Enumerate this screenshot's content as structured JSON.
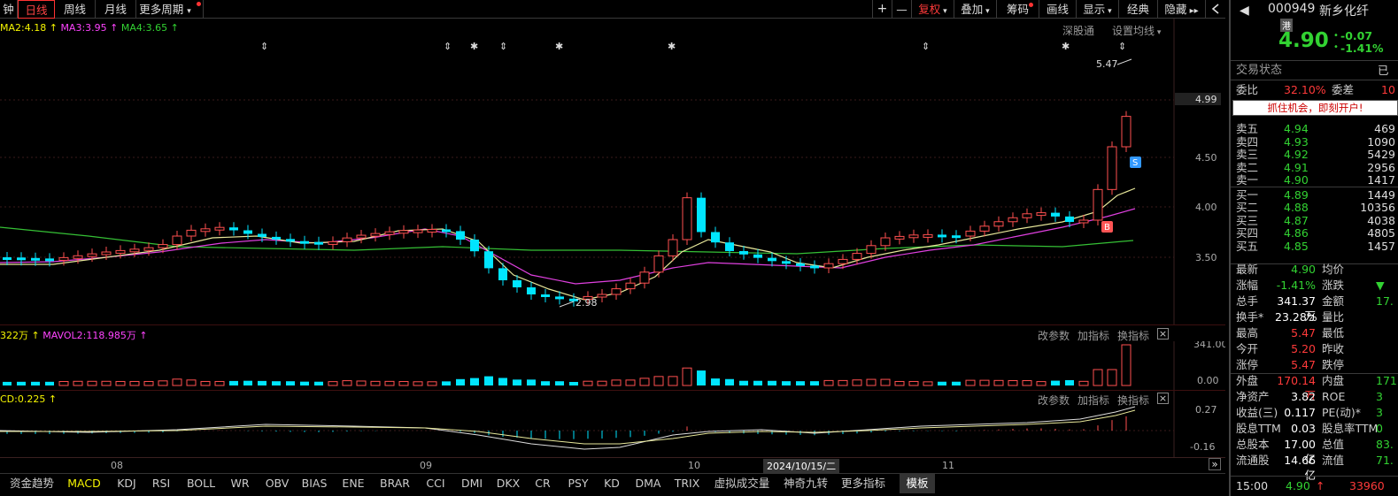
{
  "period_tabs": [
    {
      "label": "钟",
      "active": false
    },
    {
      "label": "日线",
      "active": true
    },
    {
      "label": "周线",
      "active": false
    },
    {
      "label": "月线",
      "active": false
    },
    {
      "label": "更多周期",
      "active": false
    }
  ],
  "toolbar": {
    "plus": "+",
    "minus": "—",
    "fuquan": "复权",
    "diejia": "叠加",
    "chouma": "筹码",
    "huaxian": "画线",
    "xianshi": "显示",
    "jingdian": "经典",
    "yincang": "隐藏"
  },
  "ma_legend": {
    "ma2": "MA2:4.18",
    "ma3": "MA3:3.95",
    "ma4": "MA4:3.65"
  },
  "main_links": {
    "shengutong": "深股通",
    "set_ma": "设置均线"
  },
  "chart_labels": {
    "high_price": "5.47",
    "low_price": "2.98",
    "sell_marker": "S",
    "buy_marker": "B"
  },
  "price_axis": {
    "current": "4.99",
    "ticks": [
      "4.50",
      "4.00",
      "3.50"
    ]
  },
  "volume_panel": {
    "legend_vol": "322万",
    "legend_mavol2": "MAVOL2:118.985万",
    "links": [
      "改参数",
      "加指标",
      "换指标"
    ],
    "close": "×",
    "ticks": [
      "341.00",
      "0.00"
    ]
  },
  "macd_panel": {
    "legend": "CD:0.225",
    "links": [
      "改参数",
      "加指标",
      "换指标"
    ],
    "close": "×",
    "ticks": [
      "0.27",
      "-0.16"
    ]
  },
  "date_axis": {
    "labels": [
      "08",
      "09",
      "10",
      "11"
    ],
    "cursor_date": "2024/10/15/二"
  },
  "bottom_tabs": [
    {
      "label": "资金趋势",
      "style": "normal"
    },
    {
      "label": "MACD",
      "style": "active"
    },
    {
      "label": "KDJ",
      "style": "normal"
    },
    {
      "label": "RSI",
      "style": "normal"
    },
    {
      "label": "BOLL",
      "style": "normal"
    },
    {
      "label": "WR",
      "style": "normal"
    },
    {
      "label": "OBV",
      "style": "normal"
    },
    {
      "label": "BIAS",
      "style": "normal"
    },
    {
      "label": "ENE",
      "style": "normal"
    },
    {
      "label": "BRAR",
      "style": "normal"
    },
    {
      "label": "CCI",
      "style": "normal"
    },
    {
      "label": "DMI",
      "style": "normal"
    },
    {
      "label": "DKX",
      "style": "normal"
    },
    {
      "label": "CR",
      "style": "normal"
    },
    {
      "label": "PSY",
      "style": "normal"
    },
    {
      "label": "KD",
      "style": "normal"
    },
    {
      "label": "DMA",
      "style": "normal"
    },
    {
      "label": "TRIX",
      "style": "normal"
    },
    {
      "label": "虚拟成交量",
      "style": "normal"
    },
    {
      "label": "神奇九转",
      "style": "normal"
    },
    {
      "label": "更多指标",
      "style": "normal"
    },
    {
      "label": "模板",
      "style": "gray"
    }
  ],
  "quote": {
    "code": "000949",
    "name": "新乡化纤",
    "tag": "港",
    "price": "4.90",
    "change": "-0.07",
    "change_pct": "-1.41%",
    "trade_status_label": "交易状态",
    "trade_status_value": "已",
    "webi_label": "委比",
    "webi_value": "32.10%",
    "weicha_label": "委差",
    "weicha_value": "10",
    "promo": "抓住机会，即刻开户!",
    "asks": [
      {
        "label": "卖五",
        "price": "4.94",
        "vol": "469"
      },
      {
        "label": "卖四",
        "price": "4.93",
        "vol": "1090"
      },
      {
        "label": "卖三",
        "price": "4.92",
        "vol": "5429"
      },
      {
        "label": "卖二",
        "price": "4.91",
        "vol": "2956"
      },
      {
        "label": "卖一",
        "price": "4.90",
        "vol": "1417"
      }
    ],
    "bids": [
      {
        "label": "买一",
        "price": "4.89",
        "vol": "1449"
      },
      {
        "label": "买二",
        "price": "4.88",
        "vol": "10356"
      },
      {
        "label": "买三",
        "price": "4.87",
        "vol": "4038"
      },
      {
        "label": "买四",
        "price": "4.86",
        "vol": "4805"
      },
      {
        "label": "买五",
        "price": "4.85",
        "vol": "1457"
      }
    ],
    "stats": [
      {
        "l1": "最新",
        "v1": "4.90",
        "c1": "green",
        "l2": "均价",
        "v2": ""
      },
      {
        "l1": "涨幅",
        "v1": "-1.41%",
        "c1": "green",
        "l2": "涨跌",
        "v2": "▼"
      },
      {
        "l1": "总手",
        "v1": "341.37万",
        "c1": "white",
        "l2": "金额",
        "v2": "17."
      },
      {
        "l1": "换手*",
        "v1": "23.28%",
        "c1": "white",
        "l2": "量比",
        "v2": ""
      },
      {
        "l1": "最高",
        "v1": "5.47",
        "c1": "red",
        "l2": "最低",
        "v2": ""
      },
      {
        "l1": "今开",
        "v1": "5.20",
        "c1": "red",
        "l2": "昨收",
        "v2": ""
      },
      {
        "l1": "涨停",
        "v1": "5.47",
        "c1": "red",
        "l2": "跌停",
        "v2": ""
      },
      {
        "l1": "外盘",
        "v1": "170.14万",
        "c1": "red",
        "l2": "内盘",
        "v2": "171."
      },
      {
        "l1": "净资产",
        "v1": "3.82",
        "c1": "white",
        "l2": "ROE",
        "v2": "3"
      },
      {
        "l1": "收益(三)",
        "v1": "0.117",
        "c1": "white",
        "l2": "PE(动)*",
        "v2": "3"
      },
      {
        "l1": "股息TTM",
        "v1": "0.03",
        "c1": "white",
        "l2": "股息率TTM",
        "v2": "0"
      },
      {
        "l1": "总股本",
        "v1": "17.00亿",
        "c1": "white",
        "l2": "总值",
        "v2": "83."
      },
      {
        "l1": "流通股",
        "v1": "14.66亿",
        "c1": "white",
        "l2": "流值",
        "v2": "71."
      }
    ],
    "tick_time": "15:00",
    "tick_price": "4.90",
    "tick_vol": "33960"
  }
}
